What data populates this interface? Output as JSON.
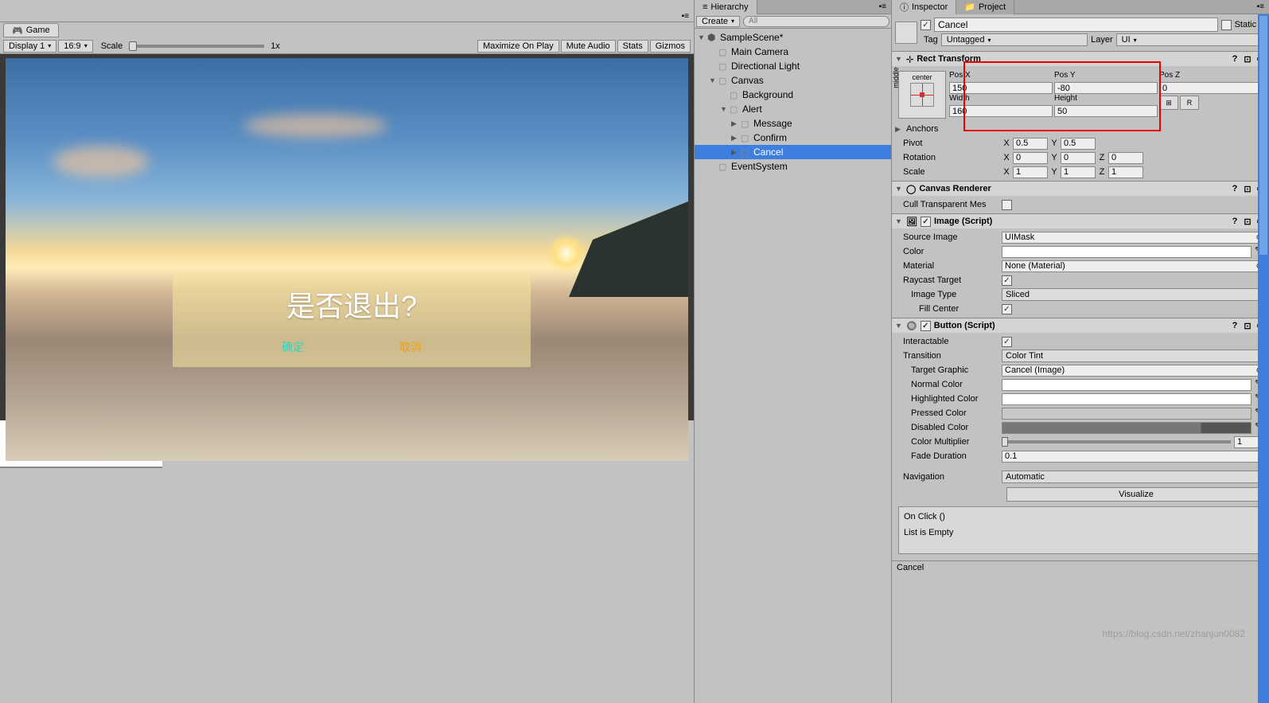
{
  "game": {
    "tab": "Game",
    "display": "Display 1",
    "aspect": "16:9",
    "scaleLabel": "Scale",
    "scaleValue": "1x",
    "maximize": "Maximize On Play",
    "muteAudio": "Mute Audio",
    "stats": "Stats",
    "gizmos": "Gizmos",
    "alertMessage": "是否退出?",
    "confirmBtn": "确定",
    "cancelBtn": "取消"
  },
  "hierarchy": {
    "tab": "Hierarchy",
    "create": "Create",
    "searchPlaceholder": "All",
    "scene": "SampleScene*",
    "items": [
      {
        "name": "Main Camera",
        "indent": 1
      },
      {
        "name": "Directional Light",
        "indent": 1
      },
      {
        "name": "Canvas",
        "indent": 1,
        "arrow": "down"
      },
      {
        "name": "Background",
        "indent": 2
      },
      {
        "name": "Alert",
        "indent": 2,
        "arrow": "down"
      },
      {
        "name": "Message",
        "indent": 3,
        "arrow": "right"
      },
      {
        "name": "Confirm",
        "indent": 3,
        "arrow": "right"
      },
      {
        "name": "Cancel",
        "indent": 3,
        "arrow": "right",
        "selected": true
      },
      {
        "name": "EventSystem",
        "indent": 1
      }
    ]
  },
  "inspector": {
    "tab": "Inspector",
    "projectTab": "Project",
    "objectName": "Cancel",
    "staticLabel": "Static",
    "tagLabel": "Tag",
    "tagValue": "Untagged",
    "layerLabel": "Layer",
    "layerValue": "UI",
    "rectTransform": {
      "title": "Rect Transform",
      "centerLabel": "center",
      "middleLabel": "middle",
      "posX": {
        "label": "Pos X",
        "value": "150"
      },
      "posY": {
        "label": "Pos Y",
        "value": "-80"
      },
      "posZ": {
        "label": "Pos Z",
        "value": "0"
      },
      "width": {
        "label": "Width",
        "value": "160"
      },
      "height": {
        "label": "Height",
        "value": "50"
      },
      "anchors": "Anchors",
      "pivot": {
        "label": "Pivot",
        "x": "0.5",
        "y": "0.5"
      },
      "rotation": {
        "label": "Rotation",
        "x": "0",
        "y": "0",
        "z": "0"
      },
      "scale": {
        "label": "Scale",
        "x": "1",
        "y": "1",
        "z": "1"
      },
      "rBtn": "R"
    },
    "canvasRenderer": {
      "title": "Canvas Renderer",
      "cullLabel": "Cull Transparent Mes"
    },
    "image": {
      "title": "Image (Script)",
      "sourceImage": {
        "label": "Source Image",
        "value": "UIMask"
      },
      "color": "Color",
      "material": {
        "label": "Material",
        "value": "None (Material)"
      },
      "raycastTarget": "Raycast Target",
      "imageType": {
        "label": "Image Type",
        "value": "Sliced"
      },
      "fillCenter": "Fill Center"
    },
    "button": {
      "title": "Button (Script)",
      "interactable": "Interactable",
      "transition": {
        "label": "Transition",
        "value": "Color Tint"
      },
      "targetGraphic": {
        "label": "Target Graphic",
        "value": "Cancel (Image)"
      },
      "normalColor": "Normal Color",
      "highlightedColor": "Highlighted Color",
      "pressedColor": "Pressed Color",
      "disabledColor": "Disabled Color",
      "colorMultiplier": {
        "label": "Color Multiplier",
        "value": "1"
      },
      "fadeDuration": {
        "label": "Fade Duration",
        "value": "0.1"
      },
      "navigation": {
        "label": "Navigation",
        "value": "Automatic"
      },
      "visualize": "Visualize",
      "onClick": "On Click ()",
      "listEmpty": "List is Empty"
    },
    "footer": "Cancel"
  },
  "watermark": "https://blog.csdn.net/zhanjun0082"
}
